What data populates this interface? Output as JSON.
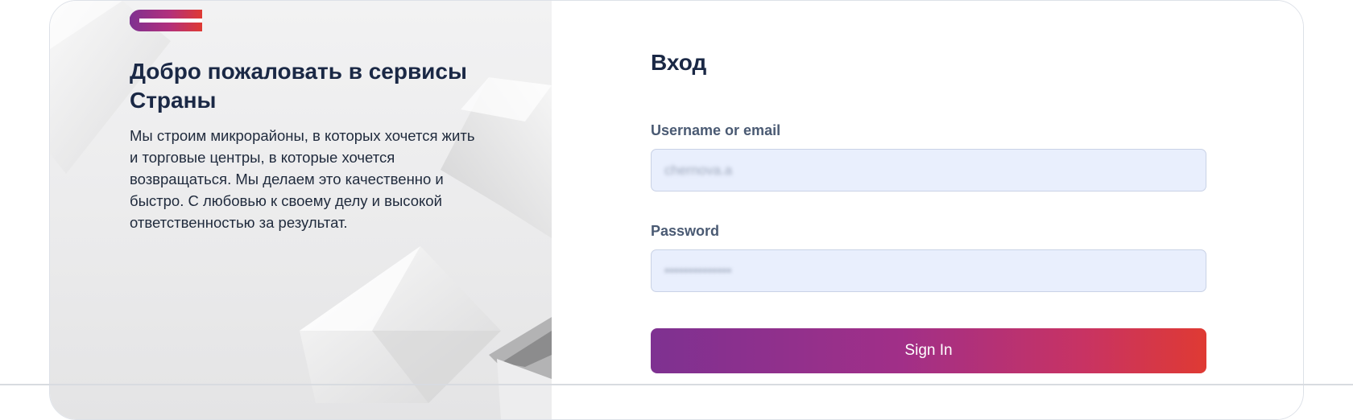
{
  "welcome": {
    "title": "Добро пожаловать в сервисы Страны",
    "text": "Мы строим микрорайоны, в которых хочется жить и торговые центры, в которые хочется возвращаться. Мы делаем это качественно и быстро. С любовью к своему делу и высокой ответственностью за результат."
  },
  "login": {
    "title": "Вход",
    "username_label": "Username or email",
    "username_value": "chernova.a",
    "password_label": "Password",
    "password_value": "••••••••••••••",
    "sign_in_label": "Sign In"
  },
  "colors": {
    "accent_start": "#7e3191",
    "accent_end": "#df3a33",
    "title": "#1a2845",
    "input_bg": "#e9effd"
  },
  "icons": {
    "logo": "brand-logo-bars"
  }
}
